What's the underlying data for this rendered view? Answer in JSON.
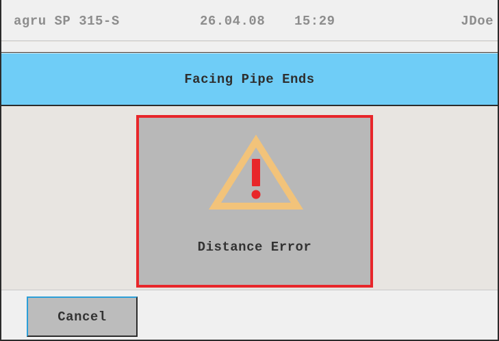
{
  "status_bar": {
    "machine_name": "agru SP 315-S",
    "date": "26.04.08",
    "time": "15:29",
    "user": "JDoe"
  },
  "title": "Facing Pipe Ends",
  "error_dialog": {
    "icon": "warning-triangle-icon",
    "message": "Distance Error",
    "border_color": "#e8262a",
    "icon_color": "#f2c37a",
    "exclamation_color": "#e8262a"
  },
  "buttons": {
    "cancel_label": "Cancel"
  },
  "colors": {
    "title_bar": "#6fcdf7",
    "focus_border": "#2a9ed8"
  }
}
